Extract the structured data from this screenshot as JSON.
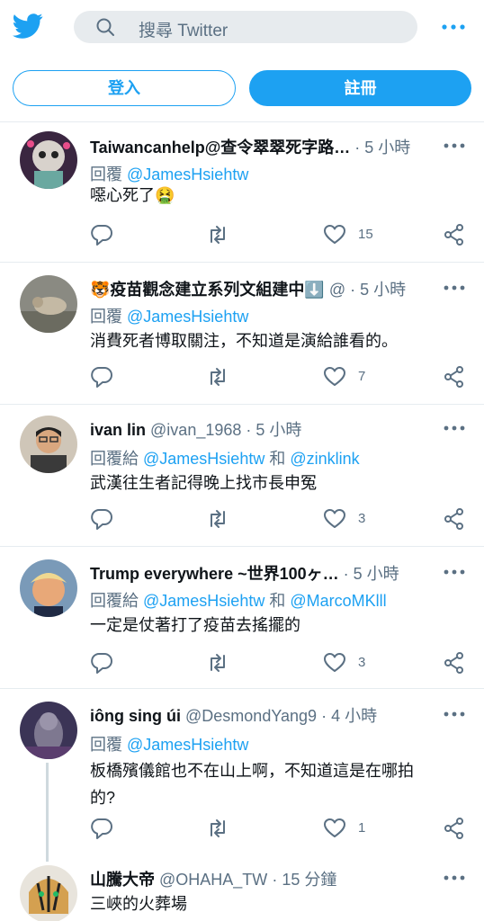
{
  "header": {
    "search_placeholder": "搜尋 Twitter",
    "login_label": "登入",
    "signup_label": "註冊"
  },
  "tweets": [
    {
      "name": "Taiwancanhelp@查令翠翠死字路…",
      "handle": "",
      "dot": "·",
      "time": "5 小時",
      "reply_prefix": "回覆",
      "reply_to": "@JamesHsiehtw",
      "reply_join": "",
      "reply_to2": "",
      "text": "噁心死了🤮",
      "likes": "15"
    },
    {
      "name": "🐯疫苗觀念建立系列文組建中⬇️",
      "handle": "@",
      "dot": "·",
      "time": "5 小時",
      "reply_prefix": "回覆",
      "reply_to": "@JamesHsiehtw",
      "reply_join": "",
      "reply_to2": "",
      "text": "消費死者博取關注，不知道是演給誰看的。",
      "likes": "7"
    },
    {
      "name": "ivan lin",
      "handle": "@ivan_1968",
      "dot": "·",
      "time": "5 小時",
      "reply_prefix": "回覆給",
      "reply_to": "@JamesHsiehtw",
      "reply_join": "和",
      "reply_to2": "@zinklink",
      "text": "武漢往生者記得晚上找市長申冤",
      "likes": "3"
    },
    {
      "name": "Trump everywhere ~世界100ヶ…",
      "handle": "",
      "dot": "·",
      "time": "5 小時",
      "reply_prefix": "回覆給",
      "reply_to": "@JamesHsiehtw",
      "reply_join": "和",
      "reply_to2": "@MarcoMKlll",
      "text": "一定是仗著打了疫苗去搖擺的",
      "likes": "3"
    },
    {
      "name": "iông sing úi",
      "handle": "@DesmondYang9",
      "dot": "·",
      "time": "4 小時",
      "reply_prefix": "回覆",
      "reply_to": "@JamesHsiehtw",
      "reply_join": "",
      "reply_to2": "",
      "text": "板橋殯儀館也不在山上啊，不知道這是在哪拍",
      "text2": "的?",
      "likes": "1"
    },
    {
      "name": "山騰大帝",
      "handle": "@OHAHA_TW",
      "dot": "·",
      "time": "15 分鐘",
      "text": "三峽的火葬場"
    }
  ],
  "colors": {
    "accent": "#1da1f2",
    "secondary_text": "#5b7083",
    "divider": "#e6ecf0"
  },
  "icons": [
    "twitter-bird-icon",
    "search-icon",
    "more-icon",
    "reply-icon",
    "retweet-icon",
    "like-icon",
    "share-icon"
  ]
}
